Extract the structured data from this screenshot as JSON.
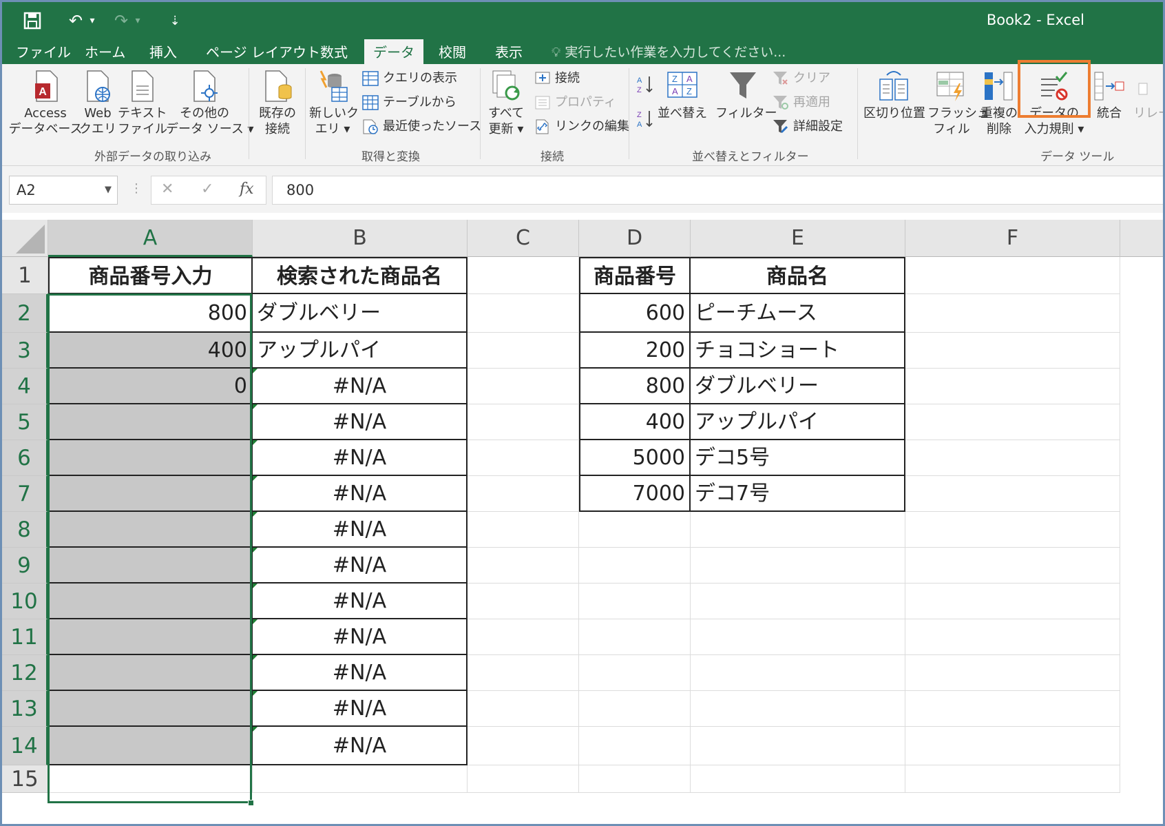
{
  "window": {
    "title": "Book2 - Excel"
  },
  "qat": {
    "save_icon": "save-icon",
    "undo": "↶",
    "undo_dd": "▾",
    "redo": "↷",
    "redo_dd": "▾",
    "customize": "⇣"
  },
  "tabs": [
    "ファイル",
    "ホーム",
    "挿入",
    "ページ レイアウト",
    "数式",
    "データ",
    "校閲",
    "表示"
  ],
  "tell_me": "実行したい作業を入力してください...",
  "ribbon": {
    "ext_data": {
      "access": "Access\nデータベース",
      "web": "Web\nクエリ",
      "text": "テキスト\nファイル",
      "other": "その他の\nデータ ソース ▾",
      "group": "外部データの取り込み"
    },
    "existing": "既存の\n接続",
    "get_transform": {
      "new_query": "新しいク\nエリ ▾",
      "show_queries": "クエリの表示",
      "from_table": "テーブルから",
      "recent_sources": "最近使ったソース",
      "group": "取得と変換"
    },
    "connections": {
      "refresh_all": "すべて\n更新 ▾",
      "connections": "接続",
      "properties": "プロパティ",
      "edit_links": "リンクの編集",
      "group": "接続"
    },
    "sort_filter": {
      "sort": "並べ替え",
      "filter": "フィルター",
      "clear": "クリア",
      "reapply": "再適用",
      "advanced": "詳細設定",
      "group": "並べ替えとフィルター"
    },
    "data_tools": {
      "text_to_columns": "区切り位置",
      "flash_fill": "フラッシュ\nフィル",
      "remove_dup": "重複の\n削除",
      "validation": "データの\n入力規則 ▾",
      "consolidate": "統合",
      "relationships": "リレー",
      "group": "データ ツール"
    }
  },
  "formula_bar": {
    "name_box": "A2",
    "cancel": "✕",
    "enter": "✓",
    "fx": "fx",
    "dots": "⋮",
    "value": "800"
  },
  "columns": [
    "A",
    "B",
    "C",
    "D",
    "E",
    "F"
  ],
  "rows": [
    "1",
    "2",
    "3",
    "4",
    "5",
    "6",
    "7",
    "8",
    "9",
    "10",
    "11",
    "12",
    "13",
    "14",
    "15"
  ],
  "sheet": {
    "headers": {
      "a1": "商品番号入力",
      "b1": "検索された商品名",
      "d1": "商品番号",
      "e1": "商品名"
    },
    "a_values": [
      "800",
      "400",
      "0",
      "",
      "",
      "",
      "",
      "",
      "",
      "",
      "",
      "",
      ""
    ],
    "b_values": [
      "ダブルベリー",
      "アップルパイ",
      "#N/A",
      "#N/A",
      "#N/A",
      "#N/A",
      "#N/A",
      "#N/A",
      "#N/A",
      "#N/A",
      "#N/A",
      "#N/A",
      "#N/A"
    ],
    "lookup": [
      {
        "code": "600",
        "name": "ピーチムース"
      },
      {
        "code": "200",
        "name": "チョコショート"
      },
      {
        "code": "800",
        "name": "ダブルベリー"
      },
      {
        "code": "400",
        "name": "アップルパイ"
      },
      {
        "code": "5000",
        "name": "デコ5号"
      },
      {
        "code": "7000",
        "name": "デコ7号"
      }
    ]
  },
  "colors": {
    "excel_green": "#217346",
    "highlight_orange": "#ed7d31",
    "selection_gray": "#c8c8c8"
  }
}
